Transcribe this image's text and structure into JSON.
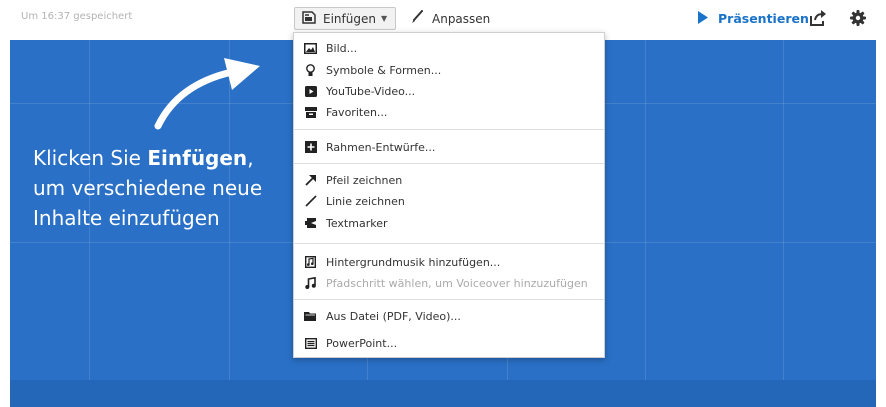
{
  "toolbar": {
    "saved_status": "Um 16:37 gespeichert",
    "insert_label": "Einfügen",
    "customize_label": "Anpassen",
    "present_label": "Präsentieren"
  },
  "hint": {
    "line1_prefix": "Klicken Sie ",
    "line1_bold": "Einfügen",
    "line1_suffix": ",",
    "line2": "um verschiedene neue",
    "line3": "Inhalte einzufügen"
  },
  "menu": {
    "items": [
      {
        "label": "Bild...",
        "icon": "image-icon"
      },
      {
        "label": "Symbole & Formen...",
        "icon": "lightbulb-icon"
      },
      {
        "label": "YouTube-Video...",
        "icon": "video-icon"
      },
      {
        "label": "Favoriten...",
        "icon": "favorites-box-icon"
      },
      {
        "label": "Rahmen-Entwürfe...",
        "icon": "frame-plus-icon"
      },
      {
        "label": "Pfeil zeichnen",
        "icon": "arrow-icon"
      },
      {
        "label": "Linie zeichnen",
        "icon": "line-icon"
      },
      {
        "label": "Textmarker",
        "icon": "highlighter-icon"
      },
      {
        "label": "Hintergrundmusik hinzufügen...",
        "icon": "music-file-icon"
      },
      {
        "label": "Pfadschritt wählen, um Voiceover hinzuzufügen",
        "icon": "music-note-icon",
        "disabled": true
      },
      {
        "label": "Aus Datei (PDF, Video)...",
        "icon": "folder-icon"
      },
      {
        "label": "PowerPoint...",
        "icon": "powerpoint-icon"
      }
    ]
  },
  "colors": {
    "canvas": "#2970c6",
    "accent": "#1a73c8"
  }
}
